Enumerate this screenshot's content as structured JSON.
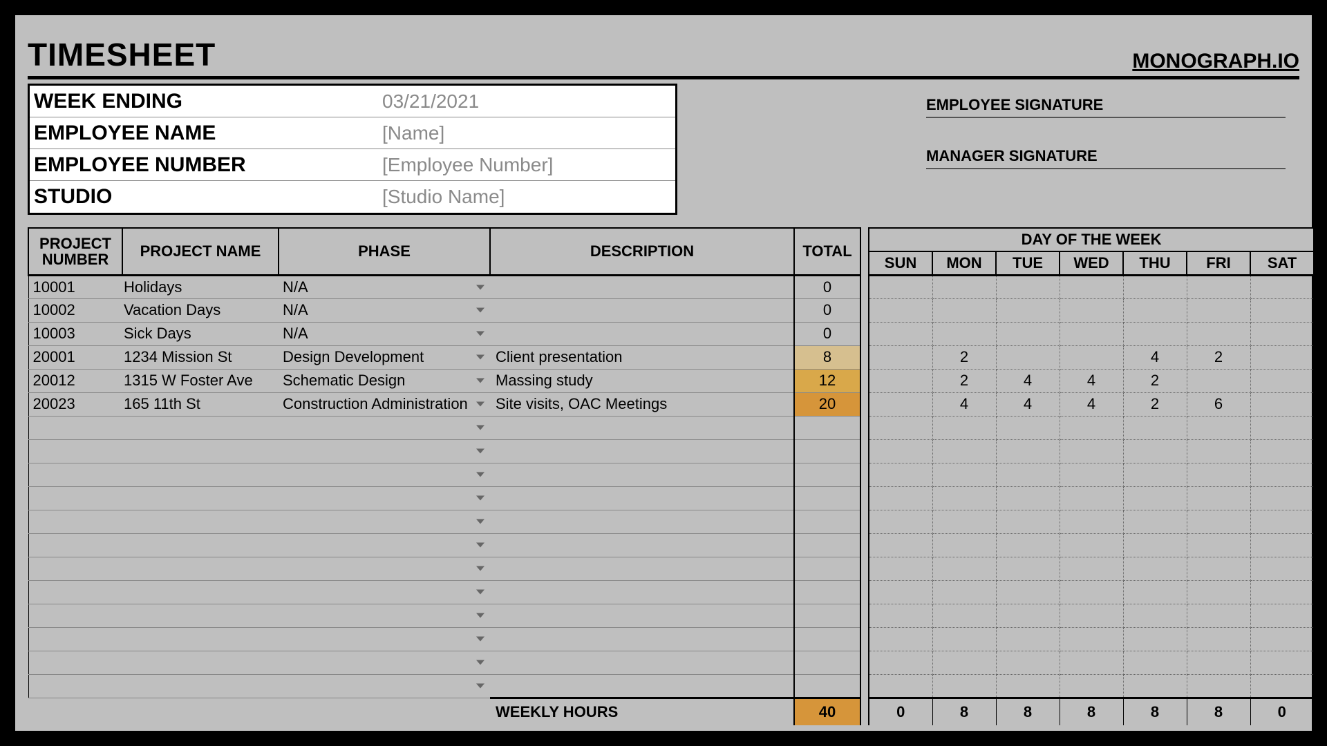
{
  "header": {
    "title": "TIMESHEET",
    "brand": "MONOGRAPH.IO"
  },
  "meta": {
    "week_ending_label": "WEEK ENDING",
    "week_ending_value": "03/21/2021",
    "employee_name_label": "EMPLOYEE NAME",
    "employee_name_value": "[Name]",
    "employee_number_label": "EMPLOYEE NUMBER",
    "employee_number_value": "[Employee Number]",
    "studio_label": "STUDIO",
    "studio_value": "[Studio Name]",
    "employee_signature_label": "EMPLOYEE SIGNATURE",
    "manager_signature_label": "MANAGER SIGNATURE"
  },
  "columns": {
    "project_number": "PROJECT NUMBER",
    "project_name": "PROJECT NAME",
    "phase": "PHASE",
    "description": "DESCRIPTION",
    "total": "TOTAL",
    "day_of_week": "DAY OF THE WEEK",
    "days": [
      "SUN",
      "MON",
      "TUE",
      "WED",
      "THU",
      "FRI",
      "SAT"
    ]
  },
  "rows": [
    {
      "num": "10001",
      "name": "Holidays",
      "phase": "N/A",
      "desc": "",
      "total": "0",
      "heat": "",
      "days": [
        "",
        "",
        "",
        "",
        "",
        "",
        ""
      ]
    },
    {
      "num": "10002",
      "name": "Vacation Days",
      "phase": "N/A",
      "desc": "",
      "total": "0",
      "heat": "",
      "days": [
        "",
        "",
        "",
        "",
        "",
        "",
        ""
      ]
    },
    {
      "num": "10003",
      "name": "Sick Days",
      "phase": "N/A",
      "desc": "",
      "total": "0",
      "heat": "",
      "days": [
        "",
        "",
        "",
        "",
        "",
        "",
        ""
      ]
    },
    {
      "num": "20001",
      "name": "1234 Mission St",
      "phase": "Design Development",
      "desc": "Client presentation",
      "total": "8",
      "heat": "lo",
      "days": [
        "",
        "2",
        "",
        "",
        "4",
        "2",
        ""
      ]
    },
    {
      "num": "20012",
      "name": "1315 W Foster Ave",
      "phase": "Schematic Design",
      "desc": "Massing study",
      "total": "12",
      "heat": "mid",
      "days": [
        "",
        "2",
        "4",
        "4",
        "2",
        "",
        ""
      ]
    },
    {
      "num": "20023",
      "name": "165 11th St",
      "phase": "Construction Administration",
      "desc": "Site visits, OAC Meetings",
      "total": "20",
      "heat": "hi",
      "days": [
        "",
        "4",
        "4",
        "4",
        "2",
        "6",
        ""
      ]
    },
    {
      "num": "",
      "name": "",
      "phase": "",
      "desc": "",
      "total": "",
      "heat": "",
      "days": [
        "",
        "",
        "",
        "",
        "",
        "",
        ""
      ]
    },
    {
      "num": "",
      "name": "",
      "phase": "",
      "desc": "",
      "total": "",
      "heat": "",
      "days": [
        "",
        "",
        "",
        "",
        "",
        "",
        ""
      ]
    },
    {
      "num": "",
      "name": "",
      "phase": "",
      "desc": "",
      "total": "",
      "heat": "",
      "days": [
        "",
        "",
        "",
        "",
        "",
        "",
        ""
      ]
    },
    {
      "num": "",
      "name": "",
      "phase": "",
      "desc": "",
      "total": "",
      "heat": "",
      "days": [
        "",
        "",
        "",
        "",
        "",
        "",
        ""
      ]
    },
    {
      "num": "",
      "name": "",
      "phase": "",
      "desc": "",
      "total": "",
      "heat": "",
      "days": [
        "",
        "",
        "",
        "",
        "",
        "",
        ""
      ]
    },
    {
      "num": "",
      "name": "",
      "phase": "",
      "desc": "",
      "total": "",
      "heat": "",
      "days": [
        "",
        "",
        "",
        "",
        "",
        "",
        ""
      ]
    },
    {
      "num": "",
      "name": "",
      "phase": "",
      "desc": "",
      "total": "",
      "heat": "",
      "days": [
        "",
        "",
        "",
        "",
        "",
        "",
        ""
      ]
    },
    {
      "num": "",
      "name": "",
      "phase": "",
      "desc": "",
      "total": "",
      "heat": "",
      "days": [
        "",
        "",
        "",
        "",
        "",
        "",
        ""
      ]
    },
    {
      "num": "",
      "name": "",
      "phase": "",
      "desc": "",
      "total": "",
      "heat": "",
      "days": [
        "",
        "",
        "",
        "",
        "",
        "",
        ""
      ]
    },
    {
      "num": "",
      "name": "",
      "phase": "",
      "desc": "",
      "total": "",
      "heat": "",
      "days": [
        "",
        "",
        "",
        "",
        "",
        "",
        ""
      ]
    },
    {
      "num": "",
      "name": "",
      "phase": "",
      "desc": "",
      "total": "",
      "heat": "",
      "days": [
        "",
        "",
        "",
        "",
        "",
        "",
        ""
      ]
    },
    {
      "num": "",
      "name": "",
      "phase": "",
      "desc": "",
      "total": "",
      "heat": "",
      "days": [
        "",
        "",
        "",
        "",
        "",
        "",
        ""
      ]
    }
  ],
  "footer": {
    "label": "WEEKLY HOURS",
    "total": "40",
    "days": [
      "0",
      "8",
      "8",
      "8",
      "8",
      "8",
      "0"
    ]
  }
}
